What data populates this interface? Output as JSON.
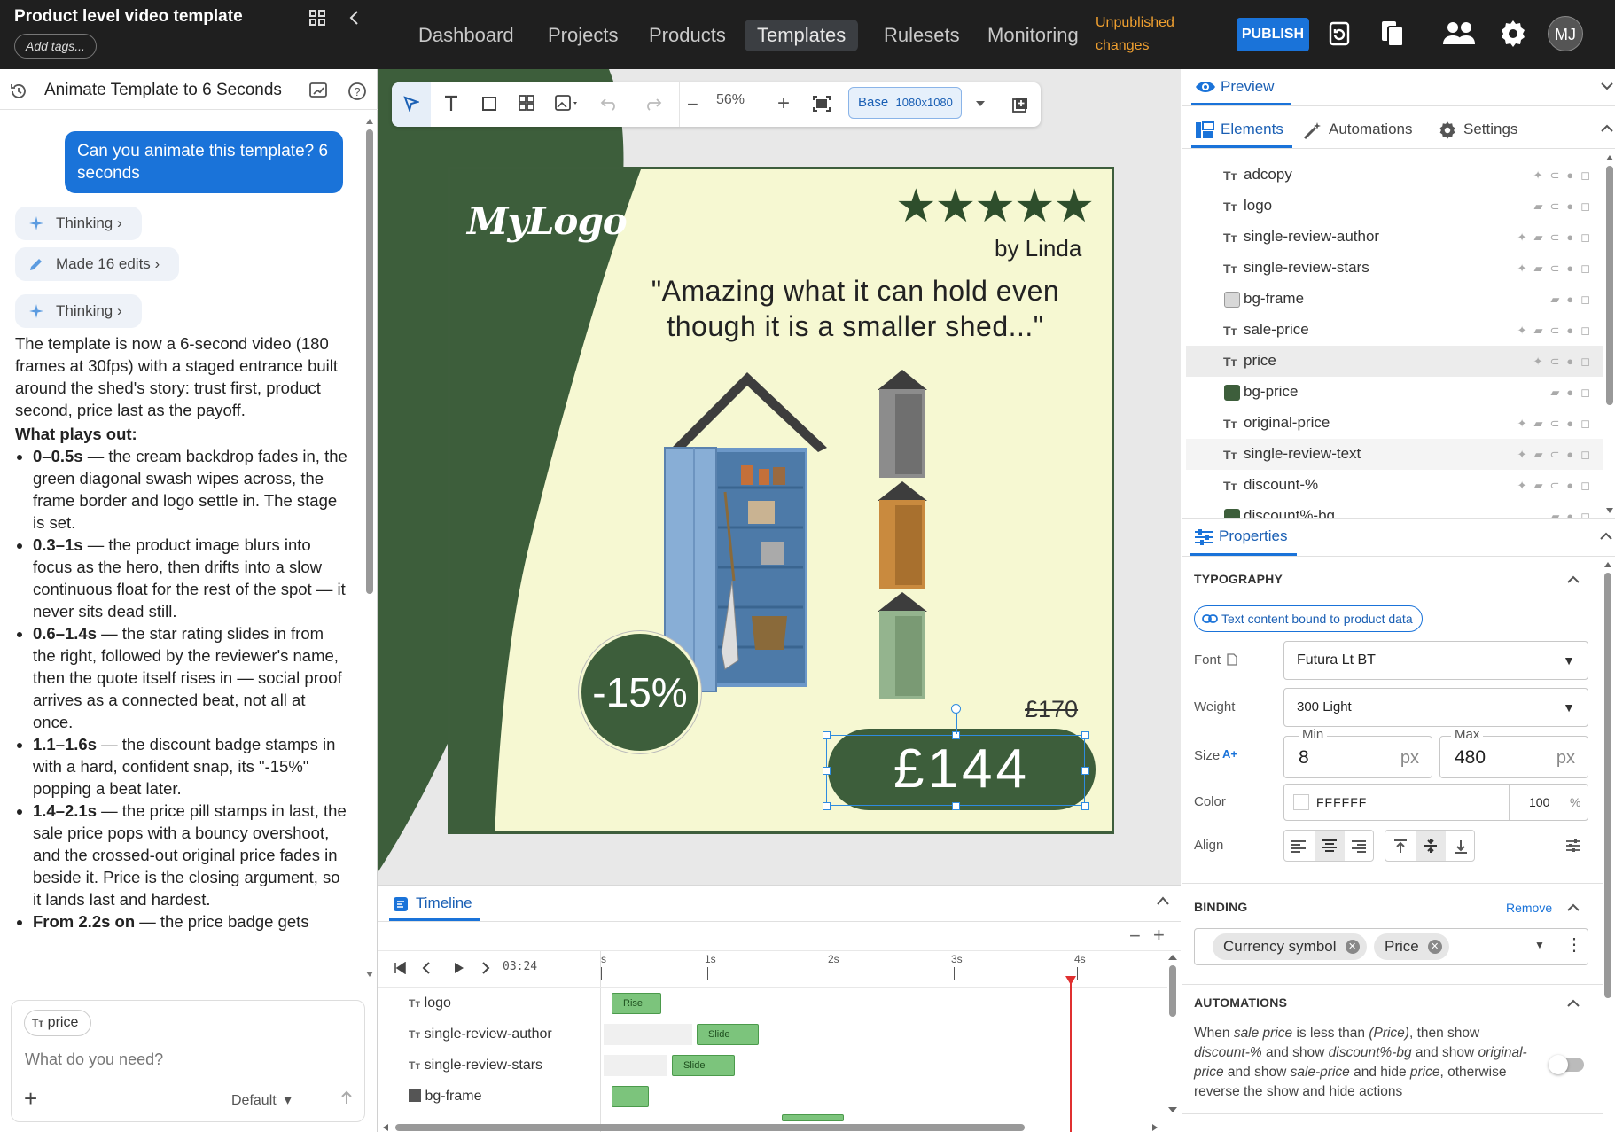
{
  "left_panel": {
    "template_title": "Product level video template",
    "add_tags": "Add tags...",
    "conversation_title": "Animate Template to 6 Seconds",
    "user_message": "Can you animate this template? 6 seconds",
    "chips": [
      "Thinking",
      "Made 16 edits",
      "Thinking"
    ],
    "assistant_intro": "The template is now a 6-second video (180 frames at 30fps) with a staged entrance built around the shed's story: trust first, product second, price last as the payoff.",
    "plays_heading": "What plays out:",
    "bullets": [
      {
        "time": "0–0.5s",
        "text": " — the cream backdrop fades in, the green diagonal swash wipes across, the frame border and logo settle in. The stage is set."
      },
      {
        "time": "0.3–1s",
        "text": " — the product image blurs into focus as the hero, then drifts into a slow continuous float for the rest of the spot — it never sits dead still."
      },
      {
        "time": "0.6–1.4s",
        "text": " — the star rating slides in from the right, followed by the reviewer's name, then the quote itself rises in — social proof arrives as a connected beat, not all at once."
      },
      {
        "time": "1.1–1.6s",
        "text": " — the discount badge stamps in with a hard, confident snap, its \"-15%\" popping a beat later."
      },
      {
        "time": "1.4–2.1s",
        "text": " — the price pill stamps in last, the sale price pops with a bouncy overshoot, and the crossed-out original price fades in beside it. Price is the closing argument, so it lands last and hardest."
      },
      {
        "time": "From 2.2s on",
        "text": " — the price badge gets"
      }
    ],
    "composer": {
      "context_chip": "price",
      "placeholder": "What do you need?",
      "model": "Default"
    }
  },
  "nav": {
    "items": [
      "Dashboard",
      "Projects",
      "Products",
      "Templates",
      "Rulesets",
      "Monitoring"
    ],
    "active": "Templates",
    "unpublished": [
      "Unpublished",
      "changes"
    ],
    "publish": "PUBLISH",
    "avatar": "MJ"
  },
  "toolbar": {
    "zoom": "56%",
    "base_label": "Base",
    "base_size": "1080x1080"
  },
  "ad": {
    "logo": "MyLogo",
    "stars": "★★★★★",
    "byline": "by Linda",
    "quote": "\"Amazing what it can hold even though it is a smaller shed...\"",
    "discount": "-15%",
    "original_price": "£170",
    "price": "£144",
    "colors": {
      "green": "#3d5e3b",
      "cream": "#f6f8d2"
    }
  },
  "timeline": {
    "title": "Timeline",
    "timecode": "03:24",
    "ticks": [
      "s",
      "1s",
      "2s",
      "3s",
      "4s"
    ],
    "rows": [
      {
        "label": "logo",
        "clip": "Rise",
        "kind": "text"
      },
      {
        "label": "single-review-author",
        "clip": "Slide",
        "kind": "text"
      },
      {
        "label": "single-review-stars",
        "clip": "Slide",
        "kind": "text"
      },
      {
        "label": "bg-frame",
        "clip": "",
        "kind": "shape"
      }
    ]
  },
  "right_panel": {
    "preview": "Preview",
    "tabs": [
      "Elements",
      "Automations",
      "Settings"
    ],
    "elements": [
      {
        "name": "adcopy",
        "kind": "text"
      },
      {
        "name": "logo",
        "kind": "text"
      },
      {
        "name": "single-review-author",
        "kind": "text"
      },
      {
        "name": "single-review-stars",
        "kind": "text"
      },
      {
        "name": "bg-frame",
        "kind": "shape",
        "color": "#d0d0d0"
      },
      {
        "name": "sale-price",
        "kind": "text"
      },
      {
        "name": "price",
        "kind": "text"
      },
      {
        "name": "bg-price",
        "kind": "shape",
        "color": "#3d5e3b"
      },
      {
        "name": "original-price",
        "kind": "text"
      },
      {
        "name": "single-review-text",
        "kind": "text"
      },
      {
        "name": "discount-%",
        "kind": "text"
      },
      {
        "name": "discount%-bg",
        "kind": "shape",
        "color": "#3d5e3b"
      }
    ],
    "properties": {
      "title": "Properties",
      "typography": "TYPOGRAPHY",
      "bound_note": "Text content bound to product data",
      "font_label": "Font",
      "font": "Futura Lt BT",
      "weight_label": "Weight",
      "weight": "300 Light",
      "size_label": "Size",
      "min_label": "Min",
      "min": "8",
      "max_label": "Max",
      "max": "480",
      "unit": "px",
      "color_label": "Color",
      "color": "FFFFFF",
      "opacity": "100",
      "opacity_unit": "%",
      "align_label": "Align"
    },
    "binding": {
      "title": "BINDING",
      "remove": "Remove",
      "pills": [
        "Currency symbol",
        "Price"
      ]
    },
    "automations": {
      "title": "AUTOMATIONS",
      "rule_parts": [
        {
          "t": "When ",
          "i": false
        },
        {
          "t": "sale price",
          "i": true
        },
        {
          "t": " is less than ",
          "i": false
        },
        {
          "t": "(Price)",
          "i": true
        },
        {
          "t": ", then show ",
          "i": false
        },
        {
          "t": "discount-%",
          "i": true
        },
        {
          "t": " and show ",
          "i": false
        },
        {
          "t": "discount%-bg",
          "i": true
        },
        {
          "t": " and show ",
          "i": false
        },
        {
          "t": "original-price",
          "i": true
        },
        {
          "t": " and show ",
          "i": false
        },
        {
          "t": "sale-price",
          "i": true
        },
        {
          "t": " and hide ",
          "i": false
        },
        {
          "t": "price",
          "i": true
        },
        {
          "t": ", otherwise reverse the show and hide actions",
          "i": false
        }
      ]
    }
  }
}
